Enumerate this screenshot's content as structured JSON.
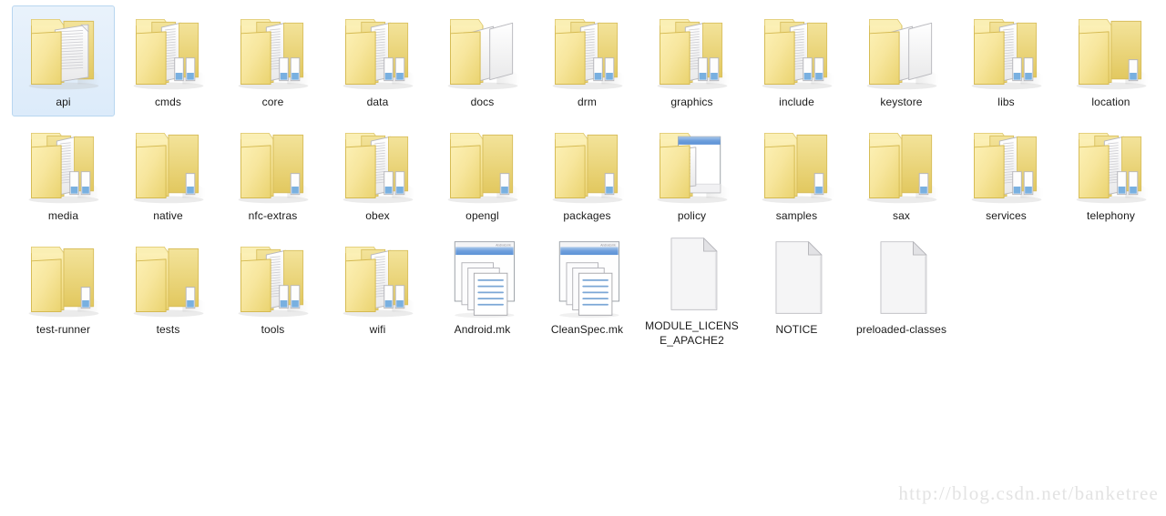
{
  "view": {
    "name": "windows-explorer-icon-view",
    "background_color": "#ffffff",
    "label_color": "#1a1a1a",
    "selection_fill": "#dcebfa",
    "selection_border": "#b8d6f0",
    "columns": 11,
    "rows": 3
  },
  "watermark": {
    "text": "http://blog.csdn.net/banketree",
    "color": "#e3e3e3"
  },
  "items": [
    {
      "label": "api",
      "icon": "folder-open-with-document-icon",
      "type": "folder",
      "selected": true
    },
    {
      "label": "cmds",
      "icon": "folder-open-with-subfolders-icon",
      "type": "folder",
      "selected": false
    },
    {
      "label": "core",
      "icon": "folder-open-with-subfolders-icon",
      "type": "folder",
      "selected": false
    },
    {
      "label": "data",
      "icon": "folder-open-with-subfolders-icon",
      "type": "folder",
      "selected": false
    },
    {
      "label": "docs",
      "icon": "folder-open-with-pages-icon",
      "type": "folder",
      "selected": false
    },
    {
      "label": "drm",
      "icon": "folder-open-with-subfolders-icon",
      "type": "folder",
      "selected": false
    },
    {
      "label": "graphics",
      "icon": "folder-open-with-subfolders-icon",
      "type": "folder",
      "selected": false
    },
    {
      "label": "include",
      "icon": "folder-open-with-subfolders-icon",
      "type": "folder",
      "selected": false
    },
    {
      "label": "keystore",
      "icon": "folder-open-with-pages-icon",
      "type": "folder",
      "selected": false
    },
    {
      "label": "libs",
      "icon": "folder-open-with-subfolders-icon",
      "type": "folder",
      "selected": false
    },
    {
      "label": "location",
      "icon": "folder-open-empty-icon",
      "type": "folder",
      "selected": false
    },
    {
      "label": "media",
      "icon": "folder-open-with-subfolders-icon",
      "type": "folder",
      "selected": false
    },
    {
      "label": "native",
      "icon": "folder-open-empty-icon",
      "type": "folder",
      "selected": false
    },
    {
      "label": "nfc-extras",
      "icon": "folder-open-empty-icon",
      "type": "folder",
      "selected": false
    },
    {
      "label": "obex",
      "icon": "folder-open-with-subfolders-icon",
      "type": "folder",
      "selected": false
    },
    {
      "label": "opengl",
      "icon": "folder-open-empty-icon",
      "type": "folder",
      "selected": false
    },
    {
      "label": "packages",
      "icon": "folder-open-empty-icon",
      "type": "folder",
      "selected": false
    },
    {
      "label": "policy",
      "icon": "folder-open-with-window-doc-icon",
      "type": "folder",
      "selected": false
    },
    {
      "label": "samples",
      "icon": "folder-open-empty-icon",
      "type": "folder",
      "selected": false
    },
    {
      "label": "sax",
      "icon": "folder-open-empty-icon",
      "type": "folder",
      "selected": false
    },
    {
      "label": "services",
      "icon": "folder-open-with-subfolders-icon",
      "type": "folder",
      "selected": false
    },
    {
      "label": "telephony",
      "icon": "folder-open-with-subfolders-icon",
      "type": "folder",
      "selected": false
    },
    {
      "label": "test-runner",
      "icon": "folder-open-empty-icon",
      "type": "folder",
      "selected": false
    },
    {
      "label": "tests",
      "icon": "folder-open-empty-icon",
      "type": "folder",
      "selected": false
    },
    {
      "label": "tools",
      "icon": "folder-open-with-subfolders-icon",
      "type": "folder",
      "selected": false
    },
    {
      "label": "wifi",
      "icon": "folder-open-with-subfolders-icon",
      "type": "folder",
      "selected": false
    },
    {
      "label": "Android.mk",
      "icon": "makefile-window-stack-icon",
      "type": "file",
      "selected": false
    },
    {
      "label": "CleanSpec.mk",
      "icon": "makefile-window-stack-icon",
      "type": "file",
      "selected": false
    },
    {
      "label": "MODULE_LICENSE_APACHE2",
      "icon": "blank-document-icon",
      "type": "file",
      "selected": false
    },
    {
      "label": "NOTICE",
      "icon": "blank-document-icon",
      "type": "file",
      "selected": false
    },
    {
      "label": "preloaded-classes",
      "icon": "blank-document-icon",
      "type": "file",
      "selected": false
    }
  ]
}
